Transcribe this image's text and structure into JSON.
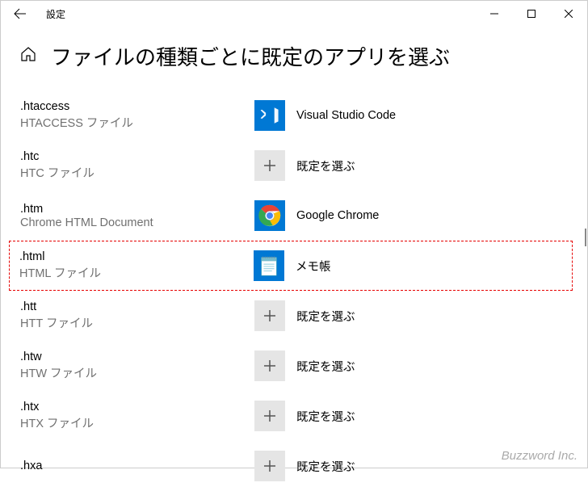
{
  "window": {
    "title": "設定"
  },
  "page": {
    "title": "ファイルの種類ごとに既定のアプリを選ぶ"
  },
  "icons": {
    "plus": "+"
  },
  "rows": [
    {
      "ext": ".htaccess",
      "desc": "HTACCESS ファイル",
      "app": "Visual Studio Code",
      "iconType": "vscode",
      "highlighted": false
    },
    {
      "ext": ".htc",
      "desc": "HTC ファイル",
      "app": "既定を選ぶ",
      "iconType": "plus",
      "highlighted": false
    },
    {
      "ext": ".htm",
      "desc": "Chrome HTML Document",
      "app": "Google Chrome",
      "iconType": "chrome",
      "highlighted": false
    },
    {
      "ext": ".html",
      "desc": "HTML ファイル",
      "app": "メモ帳",
      "iconType": "notepad",
      "highlighted": true
    },
    {
      "ext": ".htt",
      "desc": "HTT ファイル",
      "app": "既定を選ぶ",
      "iconType": "plus",
      "highlighted": false
    },
    {
      "ext": ".htw",
      "desc": "HTW ファイル",
      "app": "既定を選ぶ",
      "iconType": "plus",
      "highlighted": false
    },
    {
      "ext": ".htx",
      "desc": "HTX ファイル",
      "app": "既定を選ぶ",
      "iconType": "plus",
      "highlighted": false
    },
    {
      "ext": ".hxa",
      "desc": "",
      "app": "既定を選ぶ",
      "iconType": "plus",
      "highlighted": false
    }
  ],
  "watermark": "Buzzword Inc."
}
